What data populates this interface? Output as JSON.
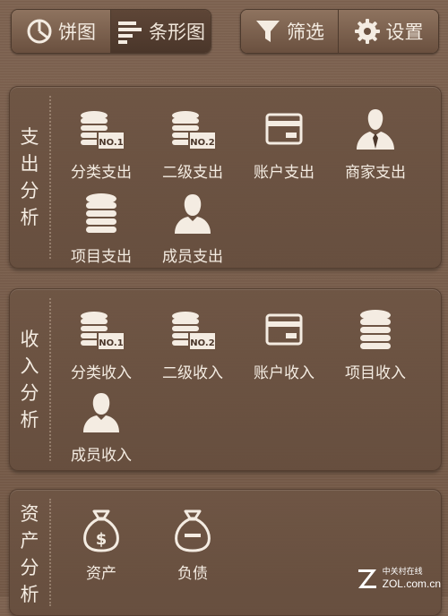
{
  "toolbar": {
    "pie_label": "饼图",
    "bar_label": "条形图",
    "filter_label": "筛选",
    "settings_label": "设置"
  },
  "expense": {
    "title_chars": [
      "支",
      "出",
      "分",
      "析"
    ],
    "items": [
      {
        "label": "分类支出",
        "icon": "coins-no1-icon"
      },
      {
        "label": "二级支出",
        "icon": "coins-no2-icon"
      },
      {
        "label": "账户支出",
        "icon": "card-icon"
      },
      {
        "label": "商家支出",
        "icon": "merchant-icon"
      },
      {
        "label": "项目支出",
        "icon": "coin-stack-icon"
      },
      {
        "label": "成员支出",
        "icon": "member-icon"
      }
    ]
  },
  "income": {
    "title_chars": [
      "收",
      "入",
      "分",
      "析"
    ],
    "items": [
      {
        "label": "分类收入",
        "icon": "coins-no1-icon"
      },
      {
        "label": "二级收入",
        "icon": "coins-no2-icon"
      },
      {
        "label": "账户收入",
        "icon": "card-icon"
      },
      {
        "label": "项目收入",
        "icon": "coin-stack-icon"
      },
      {
        "label": "成员收入",
        "icon": "member-icon"
      }
    ]
  },
  "assets": {
    "title_chars": [
      "资",
      "产",
      "分",
      "析"
    ],
    "items": [
      {
        "label": "资产",
        "icon": "money-bag-dollar-icon"
      },
      {
        "label": "负债",
        "icon": "money-bag-minus-icon"
      }
    ]
  },
  "watermark": {
    "cn": "中关村在线",
    "en": "ZOL.com.cn"
  },
  "colors": {
    "background": "#7a5f4d",
    "panel": "#6b5241",
    "text": "#f4ece2",
    "icon": "#f4ece2"
  }
}
